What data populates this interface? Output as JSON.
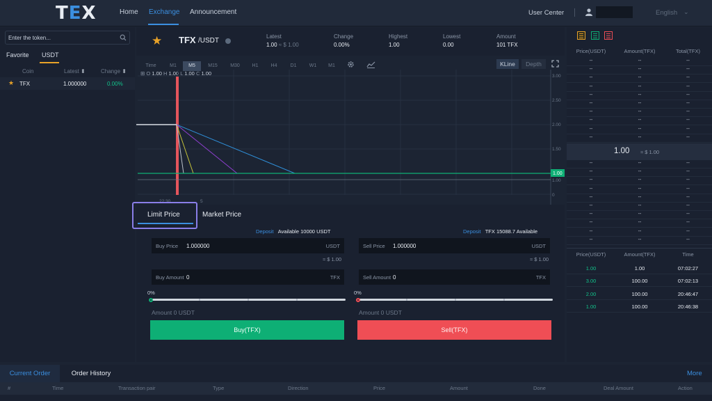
{
  "nav": {
    "logo_left": "T",
    "logo_mid": "E",
    "logo_right": "X",
    "home": "Home",
    "exchange": "Exchange",
    "announcement": "Announcement",
    "user_center": "User Center",
    "language": "English"
  },
  "sidebar": {
    "search_placeholder": "Enter the token...",
    "tabs": [
      "Favorite",
      "USDT"
    ],
    "columns": [
      "Coin",
      "Latest",
      "Change"
    ],
    "rows": [
      {
        "coin": "TFX",
        "latest": "1.000000",
        "change": "0.00%"
      }
    ]
  },
  "ticker": {
    "base": "TFX",
    "quote": "/USDT",
    "latest_label": "Latest",
    "latest_value": "1.00",
    "latest_usd": "≈ $ 1.00",
    "change_label": "Change",
    "change_value": "0.00%",
    "highest_label": "Highest",
    "highest_value": "1.00",
    "lowest_label": "Lowest",
    "lowest_value": "0.00",
    "amount_label": "Amount",
    "amount_value": "101 TFX"
  },
  "chart": {
    "timeframes": [
      "Time",
      "M1",
      "M5",
      "M15",
      "M30",
      "H1",
      "H4",
      "D1",
      "W1",
      "M1"
    ],
    "active_timeframe": "M5",
    "kline_label": "KLine",
    "depth_label": "Depth",
    "ohlc": {
      "o": "1.00",
      "h": "1.00",
      "l": "1.00",
      "c": "1.00"
    },
    "x_labels": [
      "22:30",
      "5"
    ],
    "y_ticks": [
      "3.00",
      "2.50",
      "2.00",
      "1.50",
      "1.00",
      "0"
    ],
    "current_price_tag": "1.00"
  },
  "chart_data": {
    "type": "line",
    "ylim": [
      0,
      3.2
    ],
    "y_ticks": [
      0,
      1.0,
      1.5,
      2.0,
      2.5,
      3.0
    ],
    "x_ticks": [
      "22:30",
      "5"
    ],
    "price_level": 1.0
  },
  "order": {
    "tabs": [
      "Limit Price",
      "Market Price"
    ],
    "buy": {
      "deposit": "Deposit",
      "available_label": "Available",
      "available_value": "10000",
      "available_unit": "USDT",
      "price_label": "Buy Price",
      "price_value": "1.000000",
      "price_unit": "USDT",
      "approx": "≈ $ 1.00",
      "amount_label": "Buy Amount",
      "amount_value": "0",
      "amount_unit": "TFX",
      "percent": "0%",
      "percent_fraction": 0,
      "total": "Amount 0 USDT",
      "button": "Buy(TFX)"
    },
    "sell": {
      "deposit": "Deposit",
      "available_coin": "TFX",
      "available_value": "15088.7",
      "available_label": "Available",
      "price_label": "Sell Price",
      "price_value": "1.000000",
      "price_unit": "USDT",
      "approx": "≈ $ 1.00",
      "amount_label": "Sell Amount",
      "amount_value": "0",
      "amount_unit": "TFX",
      "percent": "0%",
      "percent_fraction": 0,
      "total": "Amount 0 USDT",
      "button": "Sell(TFX)"
    }
  },
  "orderbook": {
    "columns": [
      "Price(USDT)",
      "Amount(TFX)",
      "Total(TFX)"
    ],
    "placeholder": "--",
    "mid_price": "1.00",
    "mid_usd": "≈ $ 1.00"
  },
  "trades": {
    "columns": [
      "Price(USDT)",
      "Amount(TFX)",
      "Time"
    ],
    "rows": [
      {
        "price": "1.00",
        "amount": "1.00",
        "time": "07:02:27"
      },
      {
        "price": "3.00",
        "amount": "100.00",
        "time": "07:02:13"
      },
      {
        "price": "2.00",
        "amount": "100.00",
        "time": "20:46:47"
      },
      {
        "price": "1.00",
        "amount": "100.00",
        "time": "20:46:38"
      }
    ]
  },
  "orders": {
    "tabs": [
      "Current Order",
      "Order History"
    ],
    "more": "More",
    "columns": [
      "#",
      "Time",
      "Transaction pair",
      "Type",
      "Direction",
      "Price",
      "Amount",
      "Done",
      "Deal Amount",
      "Action"
    ]
  },
  "colors": {
    "accent": "#3b8fe0",
    "buy": "#0eaf75",
    "sell": "#ef4e55",
    "star": "#e8a228"
  }
}
